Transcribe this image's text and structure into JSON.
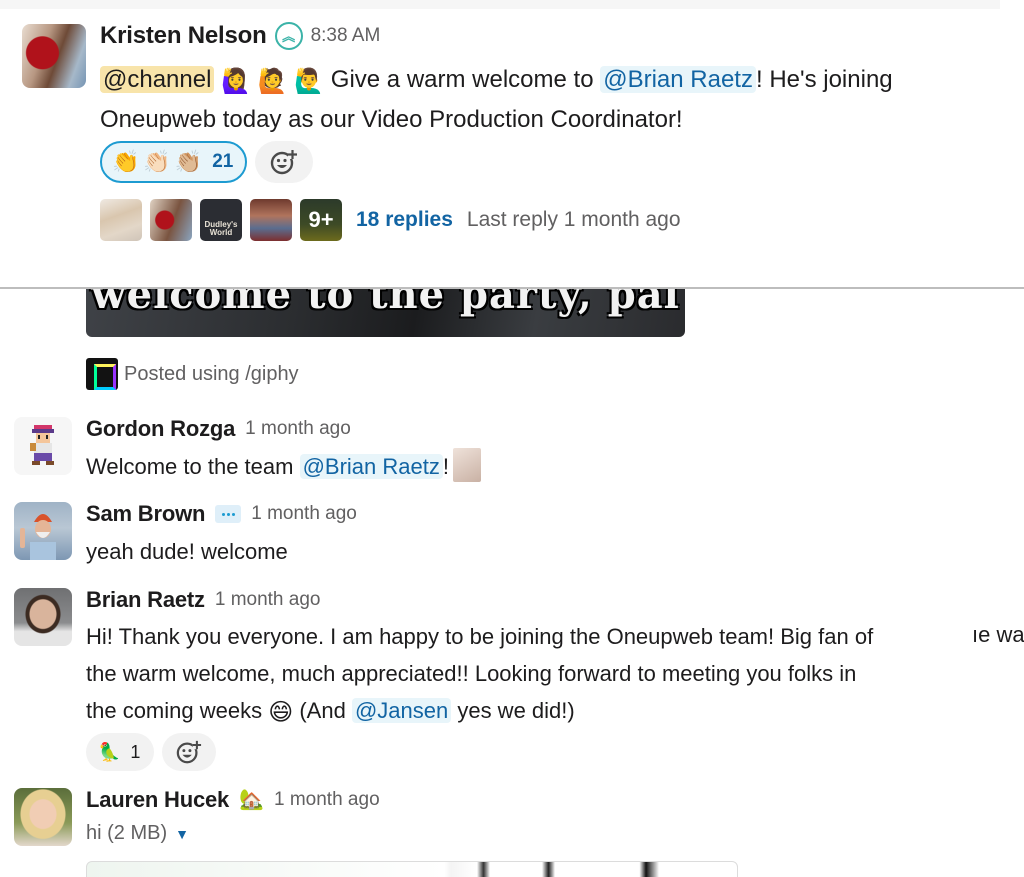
{
  "thread_parent": {
    "author": "Kristen Nelson",
    "status_icon": "upward-chevrons-badge-icon",
    "timestamp": "8:38 AM",
    "message": {
      "mention_channel": "@channel",
      "emojis": [
        "🙋‍♀️",
        "🙋",
        "🙋‍♂️"
      ],
      "text_before_mention": " Give a warm welcome to ",
      "mention_user": "@Brian Raetz",
      "text_after_mention": "! He's joining Oneupweb today as our Video Production Coordinator!"
    },
    "reaction": {
      "emojis": [
        "👏",
        "👏🏻",
        "👏🏼"
      ],
      "count": "21"
    },
    "thread": {
      "participant_badge_3": "Dudley's World",
      "overflow_badge": "9+",
      "replies_label": "18 replies",
      "last_reply": "Last reply 1 month ago"
    }
  },
  "gif": {
    "caption": "welcome to the party, pal",
    "attribution": "Posted using /giphy"
  },
  "messages": [
    {
      "author": "Gordon Rozga",
      "timestamp": "1 month ago",
      "text_before_mention": "Welcome to the team ",
      "mention_user": "@Brian Raetz",
      "text_after_mention": "!"
    },
    {
      "author": "Sam Brown",
      "status_icon": "speech-bubble-icon",
      "timestamp": "1 month ago",
      "text": "yeah dude! welcome"
    },
    {
      "author": "Brian Raetz",
      "timestamp": "1 month ago",
      "line1": "Hi! Thank you everyone. I am happy to be joining the Oneupweb team! Big fan of",
      "line1_cut": "ıe wa",
      "line2": "the warm welcome, much appreciated!! Looking forward to meeting you folks in",
      "line3_before": "the coming weeks ",
      "line3_emoji": "😄",
      "line3_mid": " (And ",
      "mention_user": "@Jansen",
      "line3_after": " yes we did!)",
      "reaction": {
        "emoji": "🦜",
        "count": "1"
      }
    },
    {
      "author": "Lauren Hucek",
      "status_icon": "house-icon",
      "status_emoji": "🏡",
      "timestamp": "1 month ago",
      "file_label": "hi (2 MB)",
      "file_caret": "▼"
    }
  ],
  "add_reaction_icon": "☺"
}
